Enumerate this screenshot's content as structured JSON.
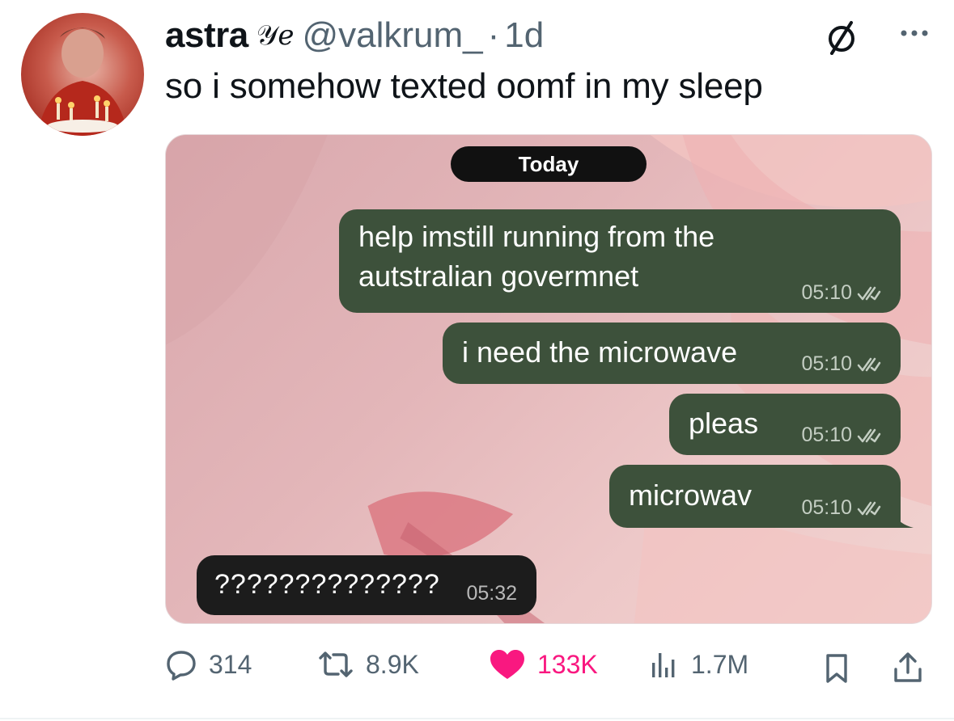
{
  "tweet": {
    "author_name": "astra",
    "author_glyph": "𝒴ℯ",
    "handle": "@valkrum_",
    "separator": "·",
    "time": "1d",
    "text": "so i somehow texted oomf in my sleep"
  },
  "chat": {
    "date_label": "Today",
    "outgoing": [
      {
        "lines": [
          "help imstill running from the",
          "autstralian govermnet"
        ],
        "time": "05:10"
      },
      {
        "lines": [
          "i need the microwave"
        ],
        "time": "05:10"
      },
      {
        "lines": [
          "pleas"
        ],
        "time": "05:10"
      },
      {
        "lines": [
          "microwav"
        ],
        "time": "05:10"
      }
    ],
    "incoming": {
      "text": "??????????????",
      "time": "05:32"
    }
  },
  "actions": {
    "replies": "314",
    "reposts": "8.9K",
    "likes": "133K",
    "views": "1.7M"
  },
  "colors": {
    "like": "#f91880",
    "secondary_text": "#536471",
    "bubble_outgoing": "#3d513b",
    "bubble_incoming": "#1c1c1c"
  },
  "icons": [
    "null-sign-icon",
    "more-icon",
    "double-check-icon",
    "reply-icon",
    "repost-icon",
    "heart-icon",
    "views-icon",
    "bookmark-icon",
    "share-icon"
  ]
}
